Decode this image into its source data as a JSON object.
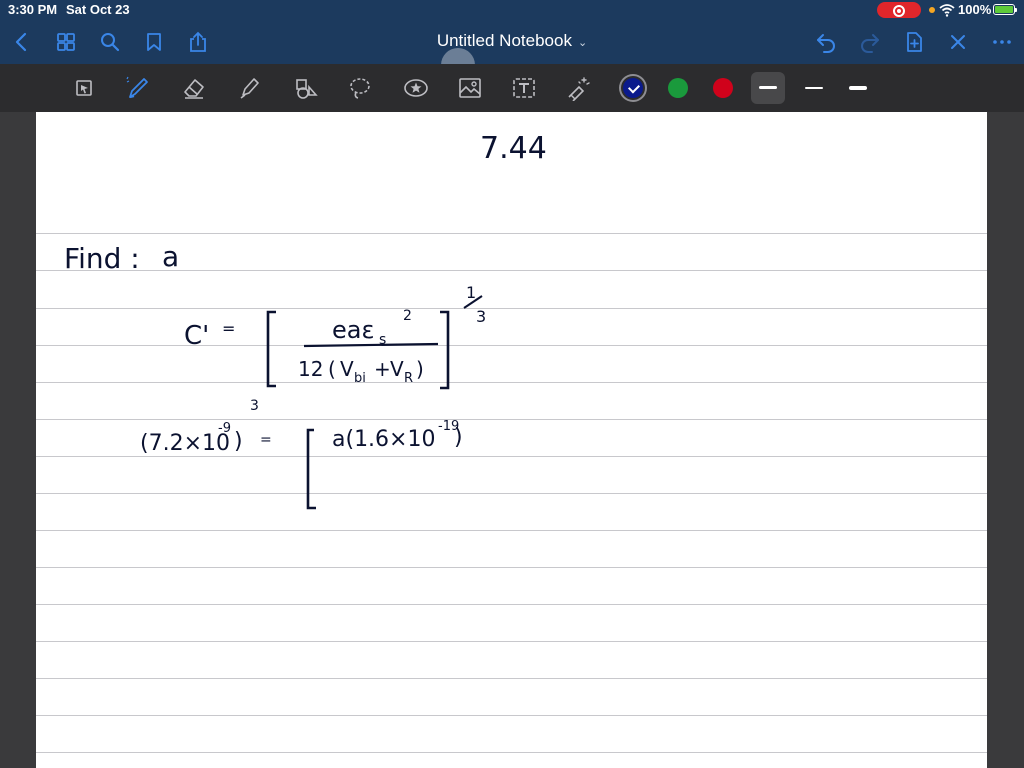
{
  "status_bar": {
    "time": "3:30 PM",
    "date": "Sat Oct 23",
    "battery": "100%",
    "icons": [
      "record-icon",
      "wifi-icon",
      "battery-icon"
    ]
  },
  "nav": {
    "title": "Untitled Notebook",
    "buttons": [
      "back-icon",
      "thumbnails-icon",
      "search-icon",
      "bookmark-icon",
      "share-icon",
      "undo-icon",
      "redo-icon",
      "add-page-icon",
      "close-icon",
      "more-icon"
    ]
  },
  "toolbar": {
    "tools": [
      "select-tool",
      "pen-tool",
      "eraser-tool",
      "highlighter-tool",
      "shapes-tool",
      "lasso-tool",
      "sticker-tool",
      "image-tool",
      "text-tool",
      "laser-pointer-tool"
    ],
    "colors": [
      "#0a1a8c",
      "#1a9a3c",
      "#d0021b"
    ],
    "selected_color": "#0a1a8c",
    "stroke_widths": [
      "thick",
      "thin",
      "medium"
    ],
    "selected_stroke": "thick"
  },
  "notes": {
    "problem_number": "7.44",
    "find_label": "Find :",
    "find_variable": "a",
    "eq1_lhs": "C'",
    "eq1_equals": "=",
    "eq1_numerator": "eaε",
    "eq1_numerator_sub": "s",
    "eq1_numerator_sup": "2",
    "eq1_denominator_coef": "12",
    "eq1_denominator_open": "(",
    "eq1_denominator_v1": "V",
    "eq1_denominator_v1_sub": "bi",
    "eq1_denominator_plus": "+",
    "eq1_denominator_v2": "V",
    "eq1_denominator_v2_sub": "R",
    "eq1_denominator_close": ")",
    "eq1_exponent_num": "1",
    "eq1_exponent_den": "3",
    "eq2_lhs": "(7.2×10",
    "eq2_lhs_exp": "-9",
    "eq2_lhs_close": ")",
    "eq2_lhs_power": "3",
    "eq2_equals": "=",
    "eq2_rhs": "a(1.6×10",
    "eq2_rhs_exp": "-19",
    "eq2_rhs_close": ")"
  }
}
